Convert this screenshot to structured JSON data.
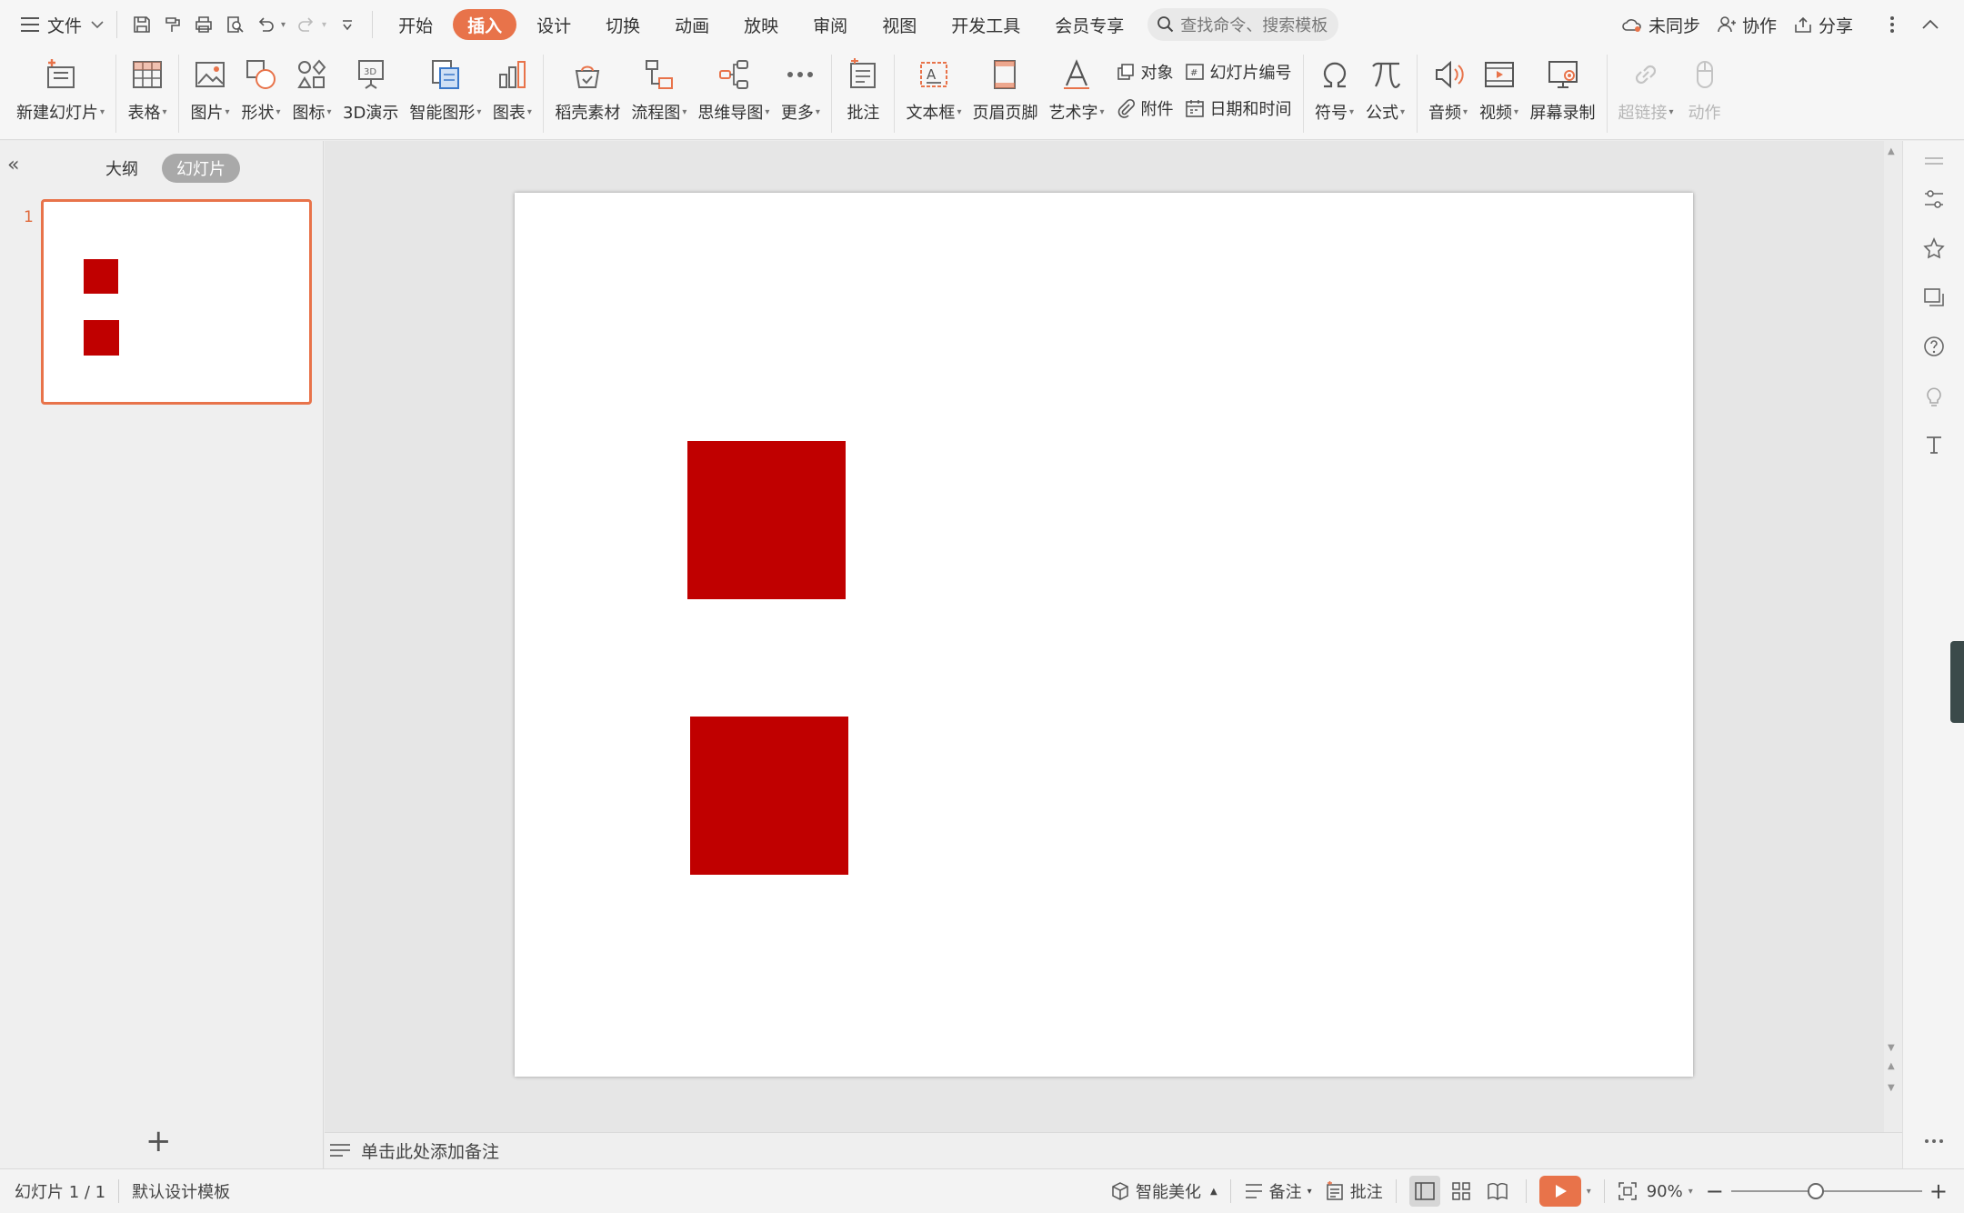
{
  "menubar": {
    "file_label": "文件",
    "tabs": [
      {
        "label": "开始"
      },
      {
        "label": "插入",
        "active": true
      },
      {
        "label": "设计"
      },
      {
        "label": "切换"
      },
      {
        "label": "动画"
      },
      {
        "label": "放映"
      },
      {
        "label": "审阅"
      },
      {
        "label": "视图"
      },
      {
        "label": "开发工具"
      },
      {
        "label": "会员专享"
      }
    ],
    "search_placeholder": "查找命令、搜索模板",
    "sync_label": "未同步",
    "collab_label": "协作",
    "share_label": "分享"
  },
  "ribbon": {
    "new_slide": "新建幻灯片",
    "table": "表格",
    "picture": "图片",
    "shape": "形状",
    "icons": "图标",
    "demo3d": "3D演示",
    "smartart": "智能图形",
    "chart": "图表",
    "material": "稻壳素材",
    "flowchart": "流程图",
    "mindmap": "思维导图",
    "more": "更多",
    "comment": "批注",
    "textbox": "文本框",
    "header_footer": "页眉页脚",
    "wordart": "艺术字",
    "object": "对象",
    "slide_number": "幻灯片编号",
    "attachment": "附件",
    "datetime": "日期和时间",
    "symbol": "符号",
    "formula": "公式",
    "audio": "音频",
    "video": "视频",
    "screen_record": "屏幕录制",
    "hyperlink": "超链接",
    "action": "动作"
  },
  "left_panel": {
    "outline_tab": "大纲",
    "slides_tab": "幻灯片",
    "slide_number": "1"
  },
  "notes": {
    "placeholder": "单击此处添加备注"
  },
  "statusbar": {
    "slide_info": "幻灯片 1 / 1",
    "template": "默认设计模板",
    "beautify": "智能美化",
    "notes": "备注",
    "comments": "批注",
    "zoom": "90%"
  },
  "colors": {
    "accent": "#e8734a",
    "shape_fill": "#c00000"
  }
}
